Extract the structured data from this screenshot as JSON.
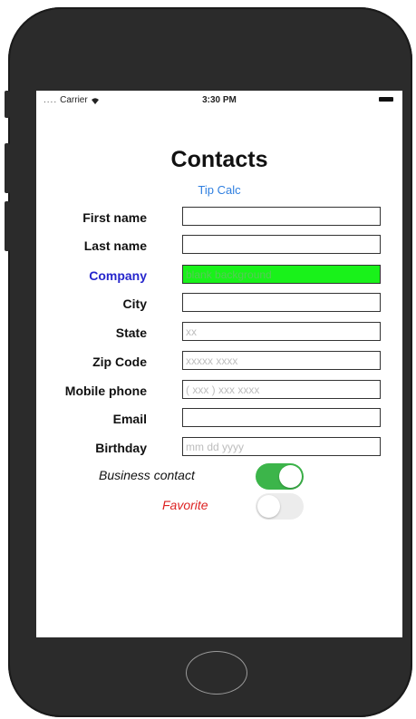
{
  "status_bar": {
    "dots": "....",
    "carrier": "Carrier",
    "wifi_icon": "wifi-icon",
    "time": "3:30 PM",
    "battery_icon": "battery-icon"
  },
  "header": {
    "title": "Contacts",
    "tip_calc_link": "Tip Calc"
  },
  "form": {
    "fields": [
      {
        "label": "First name",
        "value": "",
        "placeholder": ""
      },
      {
        "label": "Last name",
        "value": "",
        "placeholder": ""
      },
      {
        "label": "Company",
        "value": "blank background",
        "placeholder": ""
      },
      {
        "label": "City",
        "value": "",
        "placeholder": ""
      },
      {
        "label": "State",
        "value": "",
        "placeholder": "xx"
      },
      {
        "label": "Zip Code",
        "value": "",
        "placeholder": "xxxxx xxxx"
      },
      {
        "label": "Mobile phone",
        "value": "",
        "placeholder": "( xxx ) xxx xxxx"
      },
      {
        "label": "Email",
        "value": "",
        "placeholder": ""
      },
      {
        "label": "Birthday",
        "value": "",
        "placeholder": "mm dd yyyy"
      }
    ]
  },
  "switches": {
    "business_contact": {
      "label": "Business contact",
      "on": true
    },
    "favorite": {
      "label": "Favorite",
      "on": false
    }
  },
  "colors": {
    "link_blue": "#2f7fe0",
    "company_label": "#2626cc",
    "company_field_bg": "#19f21a",
    "switch_on": "#3cb54a",
    "favorite_label": "#dd2222"
  }
}
